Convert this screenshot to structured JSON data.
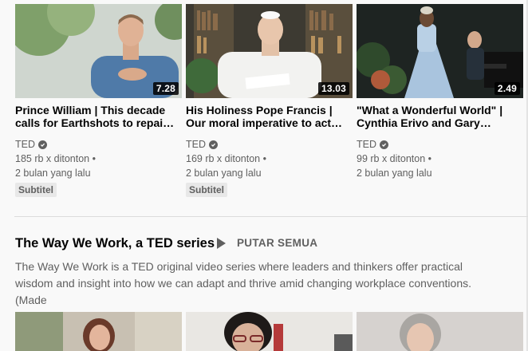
{
  "videos": [
    {
      "title": "Prince William | This decade calls for Earthshots to repai…",
      "duration": "7.28",
      "channel": "TED",
      "views": "185 rb x ditonton",
      "age": "2 bulan yang lalu",
      "badge": "Subtitel"
    },
    {
      "title": "His Holiness Pope Francis | Our moral imperative to act…",
      "duration": "13.03",
      "channel": "TED",
      "views": "169 rb x ditonton",
      "age": "2 bulan yang lalu",
      "badge": "Subtitel"
    },
    {
      "title": "\"What a Wonderful World\" | Cynthia Erivo and Gary…",
      "duration": "2.49",
      "channel": "TED",
      "views": "99 rb x ditonton",
      "age": "2 bulan yang lalu",
      "badge": ""
    }
  ],
  "shelf": {
    "title": "The Way We Work, a TED series",
    "play_all": "PUTAR SEMUA",
    "description": "The Way We Work is a TED original video series where leaders and thinkers offer practical wisdom and insight into how we can adapt and thrive amid changing workplace conventions. (Made"
  },
  "colors": {
    "background": "#f9f9f9",
    "title": "#030303",
    "meta": "#606060"
  }
}
